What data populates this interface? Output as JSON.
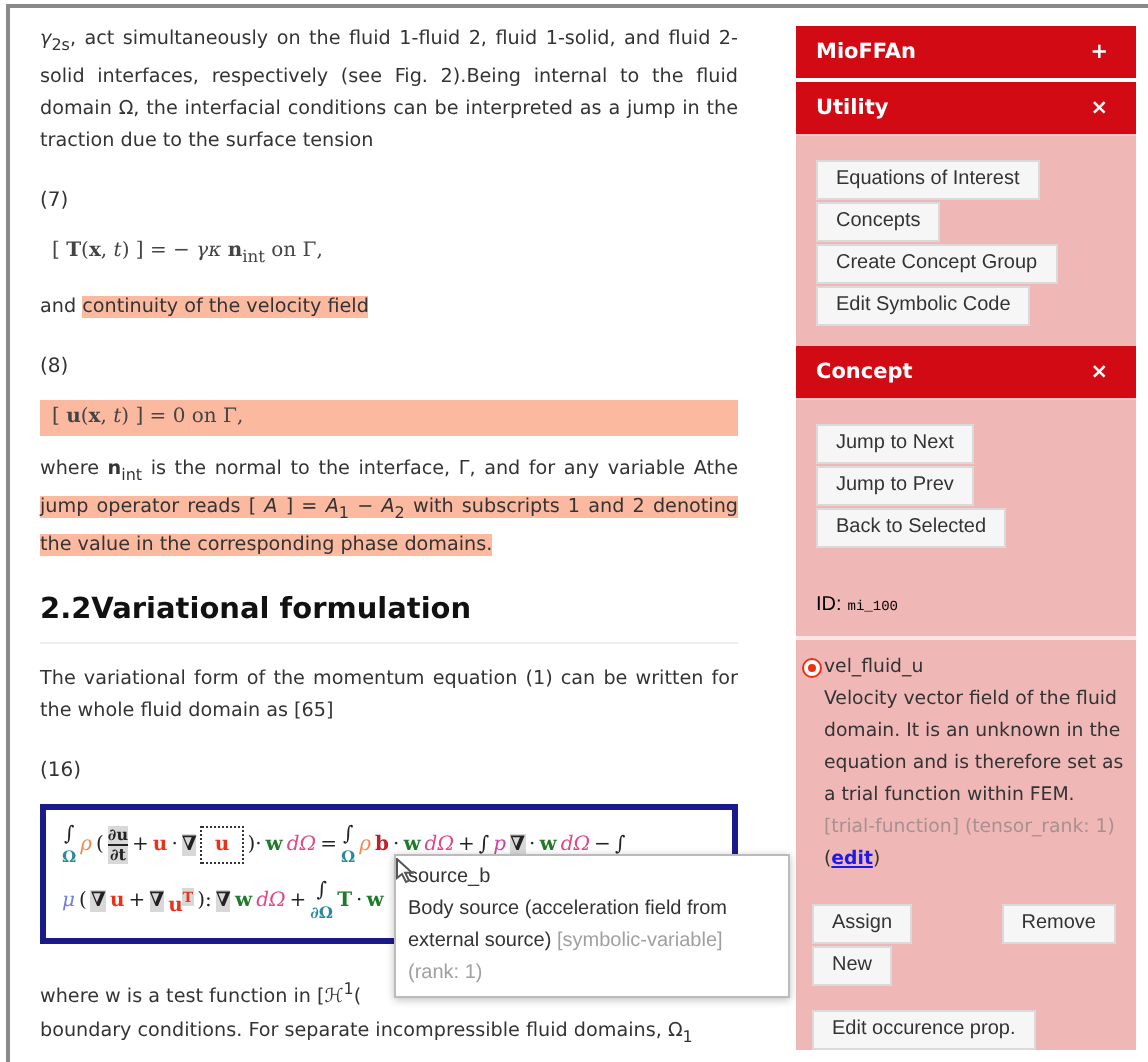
{
  "document": {
    "blocks": [
      {
        "kind": "paragraph",
        "segments": [
          {
            "text": "*γ*$_{2s}$, act simultaneously on the fluid 1-fluid 2, fluid 1-solid, and fluid 2-solid interfaces, respectively (see Fig. 2).Being internal to the fluid domain Ω, the interfacial conditions can be interpreted as a jump in the traction due to the surface tension",
            "highlighted": false
          }
        ]
      },
      {
        "kind": "number",
        "text": "(7)"
      },
      {
        "kind": "equation",
        "text": "[ **T**(**x**, *t*) ] = − *γκ* **n**$_{int}$   on Γ,",
        "highlighted": false
      },
      {
        "kind": "paragraph",
        "segments": [
          {
            "text": "and ",
            "highlighted": false
          },
          {
            "text": "continuity of the velocity field",
            "highlighted": true
          }
        ]
      },
      {
        "kind": "number",
        "text": "(8)"
      },
      {
        "kind": "equation",
        "text": "[ **u**(**x**, *t*) ] = 0   on Γ,",
        "highlighted": true
      },
      {
        "kind": "paragraph",
        "segments": [
          {
            "text": "where **n**$_{int}$ is the normal to the interface, Γ, and for any variable Athe ",
            "highlighted": false
          },
          {
            "text": "jump operator reads [ *A* ] = *A*$_{1}$ − *A*$_{2}$ with subscripts 1 and 2 denoting the value in the corresponding phase domains.",
            "highlighted": true
          }
        ]
      },
      {
        "kind": "heading",
        "text": "2.2Variational formulation"
      },
      {
        "kind": "paragraph",
        "segments": [
          {
            "text": "The variational form of the momentum equation (1) can be written for the whole fluid domain as [65]",
            "highlighted": false
          }
        ]
      },
      {
        "kind": "number",
        "text": "(16)"
      },
      {
        "kind": "equation_box",
        "lines": [
          [
            {
              "kind": "integral",
              "t": "∫",
              "sub": "Ω"
            },
            {
              "kind": "density",
              "t": "ρ"
            },
            {
              "kind": "op",
              "t": "("
            },
            {
              "kind": "frac",
              "num": "∂u",
              "den": "∂t"
            },
            {
              "kind": "op",
              "t": "+"
            },
            {
              "kind": "field",
              "t": "u"
            },
            {
              "kind": "op",
              "t": "·"
            },
            {
              "kind": "grad",
              "t": "∇"
            },
            {
              "kind": "field",
              "t": "u",
              "boxed": true
            },
            {
              "kind": "op",
              "t": ")·"
            },
            {
              "kind": "test",
              "t": "w"
            },
            {
              "kind": "measure",
              "t": "dΩ"
            },
            {
              "kind": "op",
              "t": "="
            },
            {
              "kind": "integral",
              "t": "∫",
              "sub": "Ω"
            },
            {
              "kind": "density",
              "t": "ρ"
            },
            {
              "kind": "source",
              "t": "b"
            },
            {
              "kind": "op",
              "t": "·"
            },
            {
              "kind": "test",
              "t": "w"
            },
            {
              "kind": "measure",
              "t": "dΩ"
            },
            {
              "kind": "op",
              "t": "+"
            },
            {
              "kind": "op",
              "t": "∫"
            },
            {
              "kind": "pressure",
              "t": "p"
            },
            {
              "kind": "grad",
              "t": "∇"
            },
            {
              "kind": "op",
              "t": "·"
            },
            {
              "kind": "test",
              "t": "w"
            },
            {
              "kind": "measure",
              "t": "dΩ"
            },
            {
              "kind": "op",
              "t": "−"
            },
            {
              "kind": "op",
              "t": "∫"
            }
          ],
          [
            {
              "kind": "viscosity",
              "t": "μ"
            },
            {
              "kind": "op",
              "t": "("
            },
            {
              "kind": "grad",
              "t": "∇"
            },
            {
              "kind": "field",
              "t": "u"
            },
            {
              "kind": "op",
              "t": "+"
            },
            {
              "kind": "grad",
              "t": "∇"
            },
            {
              "kind": "field",
              "t": "u",
              "sup": "T"
            },
            {
              "kind": "op",
              "t": "):"
            },
            {
              "kind": "grad",
              "t": "∇"
            },
            {
              "kind": "test",
              "t": "w"
            },
            {
              "kind": "measure",
              "t": "dΩ"
            },
            {
              "kind": "op",
              "t": "+"
            },
            {
              "kind": "integral",
              "t": "∫",
              "sub": "∂Ω"
            },
            {
              "kind": "test",
              "t": "T"
            },
            {
              "kind": "op",
              "t": "·"
            },
            {
              "kind": "test",
              "t": "w"
            }
          ]
        ]
      },
      {
        "kind": "line",
        "text": "where w is a test function in [ℋ$^{1}$("
      },
      {
        "kind": "line",
        "text": "boundary conditions. For separate incompressible fluid domains, Ω$_{1}$"
      }
    ]
  },
  "tooltip": {
    "title": "source_b",
    "description": "Body source (acceleration field from external source)",
    "meta": "[symbolic-variable] (rank: 1)"
  },
  "sidebar": {
    "panels": [
      {
        "title": "MioFFAn",
        "toggle": "+",
        "expanded": false
      },
      {
        "title": "Utility",
        "toggle": "×",
        "expanded": true,
        "buttons": [
          "Equations of Interest",
          "Concepts",
          "Create Concept Group",
          "Edit Symbolic Code"
        ]
      },
      {
        "title": "Concept",
        "toggle": "×",
        "expanded": true,
        "buttons": [
          "Jump to Next",
          "Jump to Prev",
          "Back to Selected"
        ],
        "id_label": "ID:",
        "id_value": "mi_100"
      }
    ],
    "concept": {
      "selected": true,
      "name": "vel_fluid_u",
      "description": "Velocity vector field of the fluid domain. It is an unknown in the equation and is therefore set as a trial function within FEM.",
      "meta": "[trial-function] (tensor_rank: 1)",
      "edit": {
        "before": "(",
        "link": "edit",
        "after": ")"
      },
      "buttons": [
        "Assign",
        "Remove",
        "New"
      ],
      "extra_button": "Edit occurence prop."
    }
  }
}
